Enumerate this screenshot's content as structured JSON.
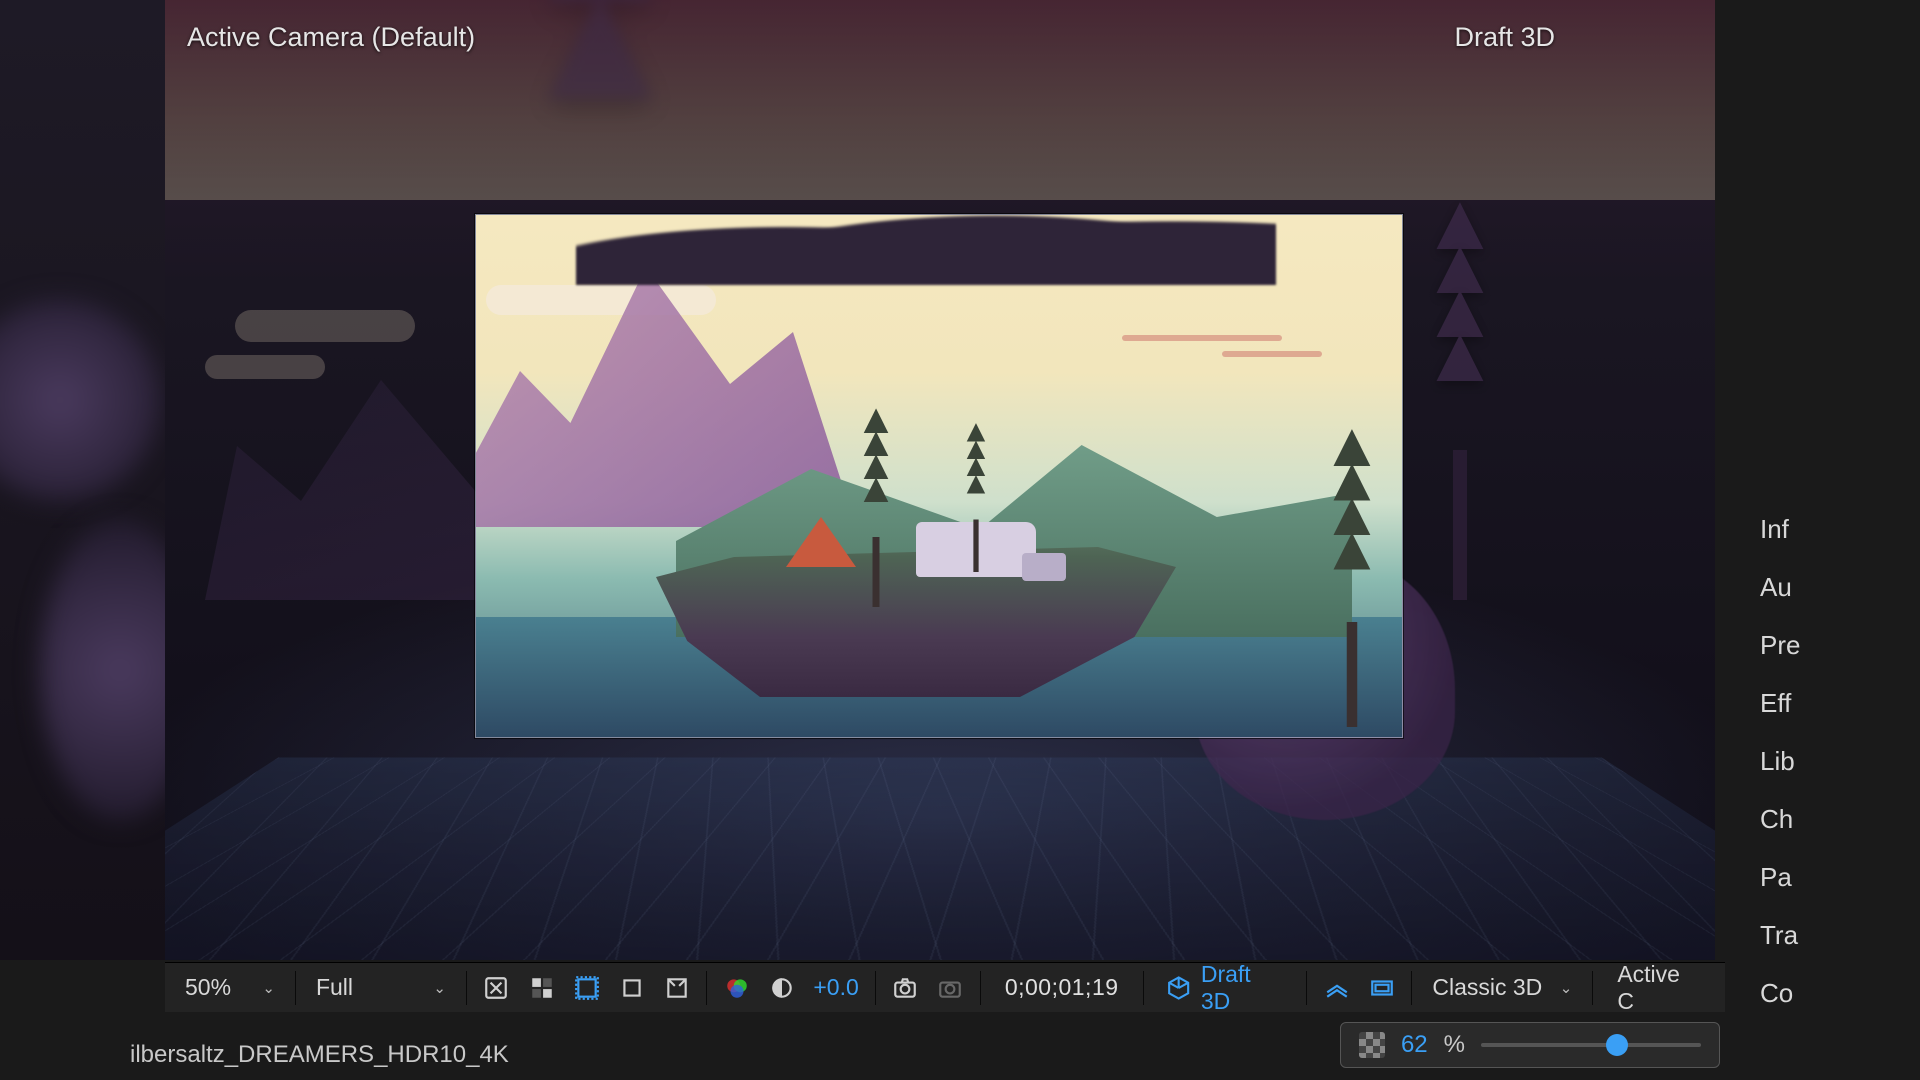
{
  "header": {
    "camera_label": "Active Camera (Default)",
    "render_mode_label": "Draft 3D"
  },
  "toolbar": {
    "zoom": "50%",
    "resolution": "Full",
    "exposure_value": "+0.0",
    "timecode": "0;00;01;19",
    "draft3d_label": "Draft 3D",
    "renderer": "Classic 3D",
    "camera_select": "Active C"
  },
  "footer": {
    "filename": "ilbersaltz_DREAMERS_HDR10_4K"
  },
  "opacity": {
    "value": "62",
    "unit": "%",
    "slider_percent": 62
  },
  "right_panel": {
    "tabs": [
      "Inf",
      "Au",
      "Pre",
      "Eff",
      "Lib",
      "Ch",
      "Pa",
      "Tra",
      "Co"
    ]
  },
  "icons": {
    "chevron": "⌄"
  }
}
